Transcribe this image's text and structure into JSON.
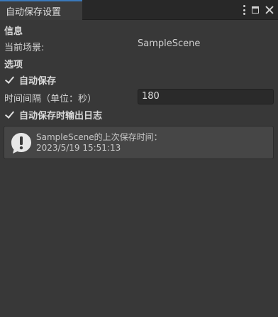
{
  "window": {
    "tab_title": "自动保存设置"
  },
  "info_section": {
    "header": "信息",
    "current_scene_label": "当前场景:",
    "current_scene_value": "SampleScene"
  },
  "options_section": {
    "header": "选项",
    "auto_save_label": "自动保存",
    "auto_save_checked": true,
    "interval_label": "时间间隔（单位：秒）",
    "interval_value": "180",
    "log_label": "自动保存时输出日志",
    "log_checked": true
  },
  "helpbox": {
    "icon": "info-exclamation-icon",
    "line1": "SampleScene的上次保存时间：",
    "line2": "2023/5/19 15:51:13"
  },
  "colors": {
    "background": "#383838",
    "tab_accent": "#3a79bb",
    "input_bg": "#2a2a2a",
    "helpbox_bg": "#464646"
  }
}
